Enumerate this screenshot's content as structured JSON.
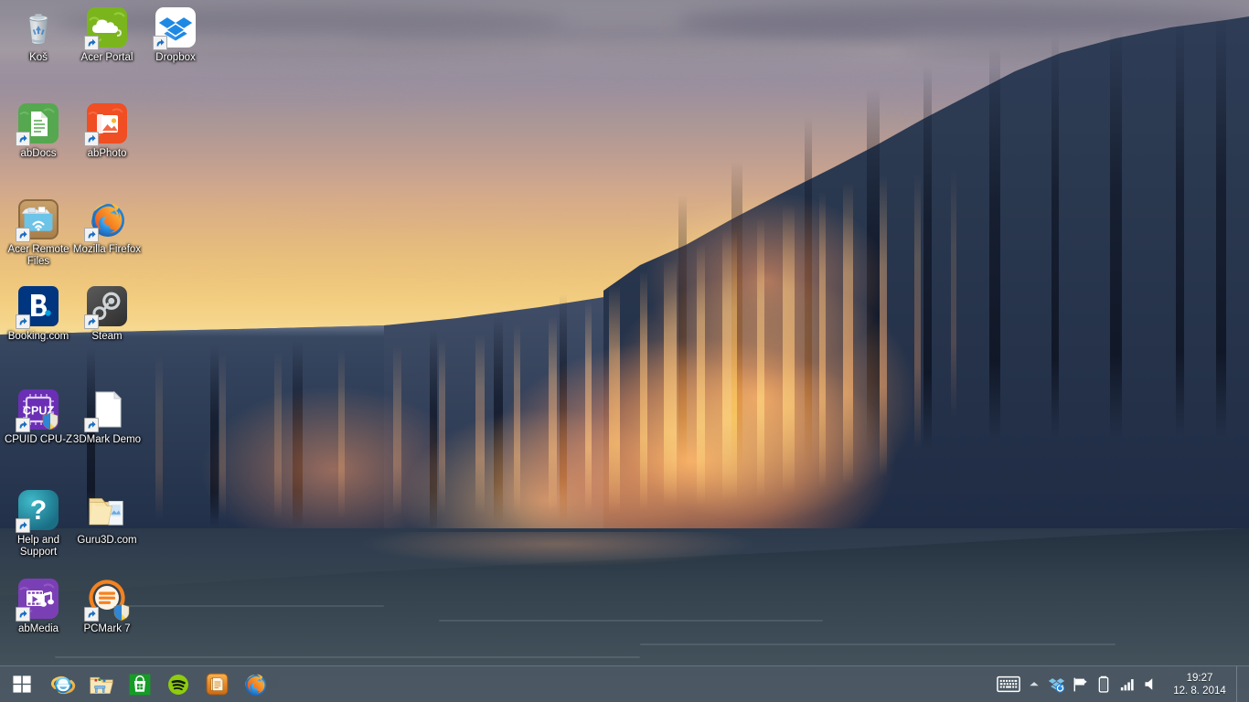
{
  "desktop": {
    "wallpaper_description": "Sunset over an ice cliff / iceberg with golden illuminated face and dark calm water",
    "colors": {
      "sky_top": "#8d8a96",
      "sky_horizon": "#f3dda3",
      "cliff_shadow": "#2a384f",
      "cliff_sunlit": "#ff922a",
      "water": "#3b4954",
      "taskbar": "#4c5864",
      "label_text": "#ffffff"
    },
    "icons": [
      {
        "name": "recycle-bin",
        "label": "Koš",
        "icon": "recycle-bin-icon",
        "shortcut": false,
        "col": 0,
        "row": 0
      },
      {
        "name": "acer-portal",
        "label": "Acer Portal",
        "icon": "acer-portal-icon",
        "shortcut": true,
        "col": 1,
        "row": 0
      },
      {
        "name": "dropbox",
        "label": "Dropbox",
        "icon": "dropbox-icon",
        "shortcut": true,
        "col": 2,
        "row": 0
      },
      {
        "name": "abdocs",
        "label": "abDocs",
        "icon": "abdocs-icon",
        "shortcut": true,
        "col": 0,
        "row": 1
      },
      {
        "name": "abphoto",
        "label": "abPhoto",
        "icon": "abphoto-icon",
        "shortcut": true,
        "col": 1,
        "row": 1
      },
      {
        "name": "acer-remote-files",
        "label": "Acer Remote Files",
        "icon": "acer-remote-files-icon",
        "shortcut": true,
        "col": 0,
        "row": 2
      },
      {
        "name": "mozilla-firefox",
        "label": "Mozilla Firefox",
        "icon": "firefox-icon",
        "shortcut": true,
        "col": 1,
        "row": 2
      },
      {
        "name": "booking-com",
        "label": "Booking.com",
        "icon": "booking-icon",
        "shortcut": true,
        "col": 0,
        "row": 3
      },
      {
        "name": "steam",
        "label": "Steam",
        "icon": "steam-icon",
        "shortcut": true,
        "col": 1,
        "row": 3
      },
      {
        "name": "cpuid-cpu-z",
        "label": "CPUID CPU-Z",
        "icon": "cpuz-icon",
        "shortcut": true,
        "col": 0,
        "row": 4
      },
      {
        "name": "3dmark-demo",
        "label": "3DMark Demo",
        "icon": "blank-document-icon",
        "shortcut": true,
        "col": 1,
        "row": 4
      },
      {
        "name": "help-and-support",
        "label": "Help and Support",
        "icon": "help-icon",
        "shortcut": true,
        "col": 0,
        "row": 5
      },
      {
        "name": "guru3d-com",
        "label": "Guru3D.com",
        "icon": "folder-icon",
        "shortcut": false,
        "col": 1,
        "row": 5
      },
      {
        "name": "abmedia",
        "label": "abMedia",
        "icon": "abmedia-icon",
        "shortcut": true,
        "col": 0,
        "row": 6
      },
      {
        "name": "pcmark-7",
        "label": "PCMark 7",
        "icon": "pcmark7-icon",
        "shortcut": true,
        "col": 1,
        "row": 6
      }
    ]
  },
  "taskbar": {
    "start_button_label": "Start",
    "apps": [
      {
        "name": "internet-explorer",
        "label": "Internet Explorer",
        "icon": "internet-explorer-icon"
      },
      {
        "name": "file-explorer",
        "label": "File Explorer",
        "icon": "file-explorer-icon"
      },
      {
        "name": "windows-store",
        "label": "Store",
        "icon": "windows-store-icon"
      },
      {
        "name": "spotify",
        "label": "Spotify",
        "icon": "spotify-icon"
      },
      {
        "name": "notes-app",
        "label": "Notes",
        "icon": "notes-icon"
      },
      {
        "name": "firefox",
        "label": "Mozilla Firefox",
        "icon": "firefox-icon"
      }
    ],
    "tray": [
      {
        "name": "touch-keyboard",
        "label": "Touch keyboard",
        "icon": "keyboard-icon"
      },
      {
        "name": "show-hidden",
        "label": "Show hidden icons",
        "icon": "chevron-up-icon"
      },
      {
        "name": "dropbox-tray",
        "label": "Dropbox",
        "icon": "dropbox-sync-icon"
      },
      {
        "name": "action-center",
        "label": "Action Center",
        "icon": "flag-icon"
      },
      {
        "name": "battery",
        "label": "Battery",
        "icon": "battery-icon"
      },
      {
        "name": "network",
        "label": "Network",
        "icon": "signal-bars-icon"
      },
      {
        "name": "volume",
        "label": "Volume",
        "icon": "speaker-icon"
      }
    ],
    "clock": {
      "time": "19:27",
      "date": "12. 8. 2014"
    }
  }
}
